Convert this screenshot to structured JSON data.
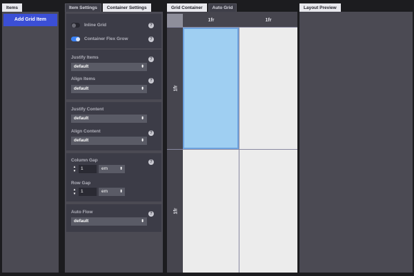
{
  "items_panel": {
    "tab": "Items",
    "add_button": "Add Grid Item"
  },
  "settings_panel": {
    "tabs": [
      "Item Settings",
      "Container Settings"
    ],
    "active_tab": "Container Settings",
    "inline_grid": {
      "label": "Inline Grid",
      "enabled": false
    },
    "container_flex_grow": {
      "label": "Container Flex Grow",
      "enabled": true
    },
    "justify_items": {
      "label": "Justify Items",
      "value": "default"
    },
    "align_items": {
      "label": "Align Items",
      "value": "default"
    },
    "justify_content": {
      "label": "Justify Content",
      "value": "default"
    },
    "align_content": {
      "label": "Align Content",
      "value": "default"
    },
    "column_gap": {
      "label": "Column Gap",
      "value": "1",
      "unit": "em"
    },
    "row_gap": {
      "label": "Row Gap",
      "value": "1",
      "unit": "em"
    },
    "auto_flow": {
      "label": "Auto Flow",
      "value": "default"
    },
    "help_glyph": "?"
  },
  "grid_panel": {
    "tabs": [
      "Grid Container",
      "Auto Grid"
    ],
    "active_tab": "Grid Container",
    "columns": [
      "1fr",
      "1fr"
    ],
    "rows": [
      "1fr",
      "1fr"
    ],
    "selected_cell": "row 1, column 1"
  },
  "preview_panel": {
    "tab": "Layout Preview"
  },
  "colors": {
    "accent_button": "#3b4fd6",
    "toggle_on": "#3b82f6",
    "selected_cell": "#9fcff2"
  }
}
